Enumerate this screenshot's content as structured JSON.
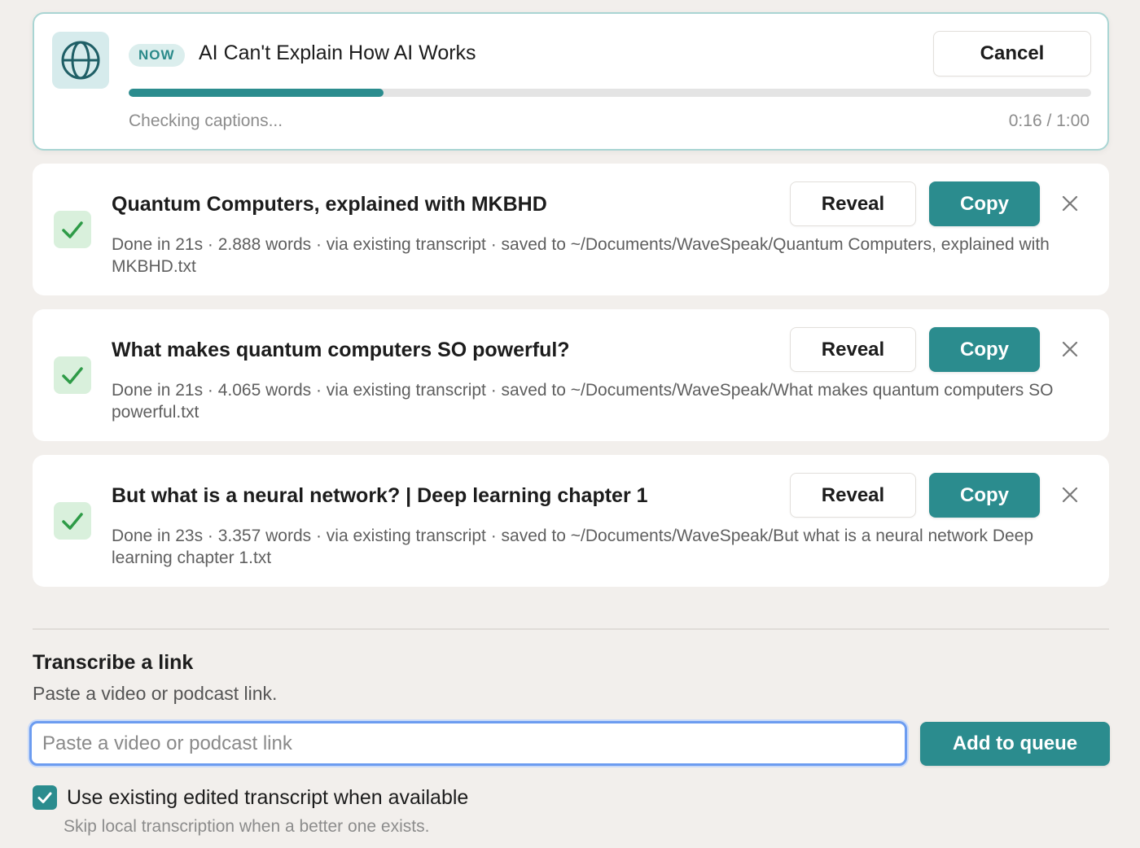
{
  "current_job": {
    "badge": "NOW",
    "title": "AI Can't Explain How AI Works",
    "cancel_label": "Cancel",
    "progress_fraction": 0.265,
    "status": "Checking captions...",
    "time": "0:16 / 1:00",
    "icon": "globe-icon"
  },
  "completed": [
    {
      "title": "Quantum Computers, explained with MKBHD",
      "meta": "Done in 21s · 2.888 words · via existing transcript · saved to ~/Documents/WaveSpeak/Quantum Computers, explained with MKBHD.txt",
      "reveal_label": "Reveal",
      "copy_label": "Copy"
    },
    {
      "title": "What makes quantum computers SO powerful?",
      "meta": "Done in 21s · 4.065 words · via existing transcript · saved to ~/Documents/WaveSpeak/What makes quantum computers SO powerful.txt",
      "reveal_label": "Reveal",
      "copy_label": "Copy"
    },
    {
      "title": "But what is a neural network? | Deep learning chapter 1",
      "meta": "Done in 23s · 3.357 words · via existing transcript · saved to ~/Documents/WaveSpeak/But what is a neural network Deep learning chapter 1.txt",
      "reveal_label": "Reveal",
      "copy_label": "Copy"
    }
  ],
  "transcribe": {
    "title": "Transcribe a link",
    "subtitle": "Paste a video or podcast link.",
    "input_placeholder": "Paste a video or podcast link",
    "input_value": "",
    "add_label": "Add to queue",
    "checkbox_checked": true,
    "checkbox_label": "Use existing edited transcript when available",
    "checkbox_help": "Skip local transcription when a better one exists."
  },
  "colors": {
    "accent": "#2b8c8e",
    "background": "#f2efec",
    "success_tint": "#d9f0dc",
    "success_check": "#2e9b47"
  }
}
